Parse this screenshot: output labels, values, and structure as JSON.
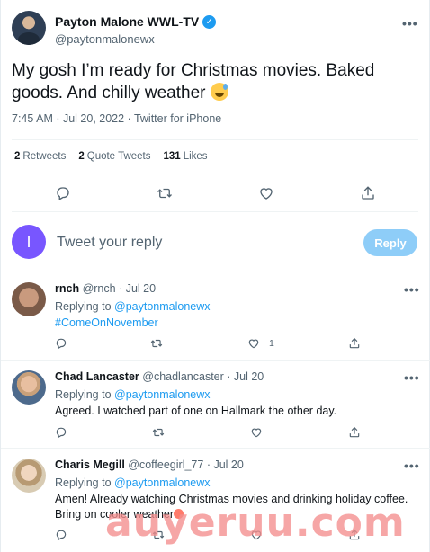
{
  "tweet": {
    "display_name": "Payton Malone WWL-TV",
    "handle": "@paytonmalonewx",
    "text": "My gosh I’m ready for Christmas movies. Baked goods. And chilly weather",
    "meta": "7:45 AM · Jul 20, 2022 · Twitter for iPhone",
    "stats": [
      {
        "count": "2",
        "label": "Retweets"
      },
      {
        "count": "2",
        "label": "Quote Tweets"
      },
      {
        "count": "131",
        "label": "Likes"
      }
    ],
    "more": "•••"
  },
  "composer": {
    "avatar_letter": "I",
    "placeholder": "Tweet your reply",
    "reply_label": "Reply"
  },
  "replies": [
    {
      "name": "rnch",
      "handle": "@rnch",
      "time": "· Jul 20",
      "replying_prefix": "Replying to",
      "replying_to": "@paytonmalonewx",
      "text": "#ComeOnNovember",
      "like_count": "1"
    },
    {
      "name": "Chad Lancaster",
      "handle": "@chadlancaster",
      "time": "· Jul 20",
      "replying_prefix": "Replying to",
      "replying_to": "@paytonmalonewx",
      "text": "Agreed. I watched part of one on Hallmark the other day.",
      "like_count": ""
    },
    {
      "name": "Charis Megill",
      "handle": "@coffeegirl_77",
      "time": "· Jul 20",
      "replying_prefix": "Replying to",
      "replying_to": "@paytonmalonewx",
      "text_line1": "Amen! Already watching Christmas movies and drinking holiday coffee.",
      "text_line2": "Bring on cooler weather",
      "like_count": ""
    }
  ],
  "watermark": "auyeruu.com",
  "colors": {
    "accent": "#1d9bf0",
    "reply_button": "#8ecdf8",
    "composer_avatar": "#7856ff",
    "muted_text": "#536471"
  },
  "icons": [
    "verified-badge-icon",
    "more-icon",
    "reply-icon",
    "retweet-icon",
    "like-icon",
    "share-icon"
  ]
}
